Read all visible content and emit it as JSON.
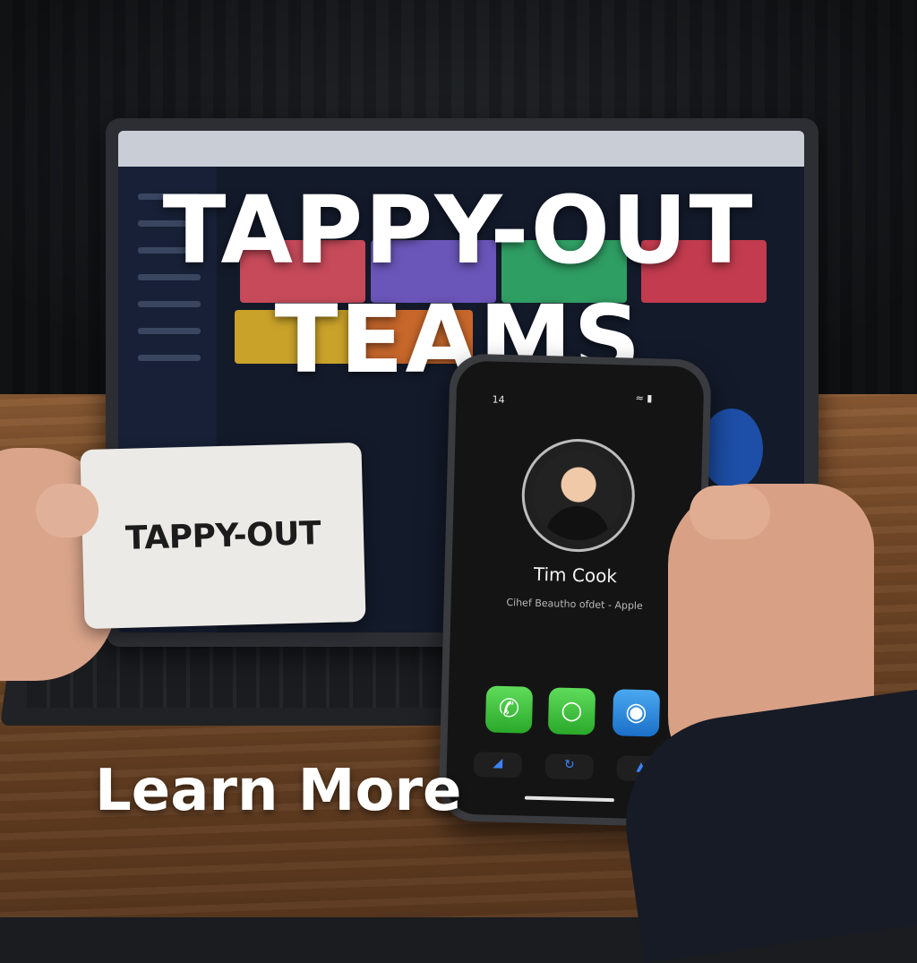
{
  "headline": {
    "line1": "TAPPY-OUT",
    "line2": "TEAMS"
  },
  "card": {
    "brand": "TAPPY-OUT"
  },
  "phone": {
    "status_time": "14",
    "contact_name": "Tim Cook",
    "contact_title": "Cihef Beautho ofdet - Apple",
    "apps": [
      "phone-icon",
      "message-icon",
      "globe-icon"
    ],
    "dock": [
      "triangle-icon",
      "refresh-icon",
      "navigation-arrow-icon"
    ]
  },
  "cta": {
    "label": "Learn More"
  },
  "colors": {
    "text": "#ffffff",
    "desk": "#6e4525",
    "card": "#eceae6",
    "app_green": "#34c759",
    "app_blue": "#1b6fc9"
  }
}
